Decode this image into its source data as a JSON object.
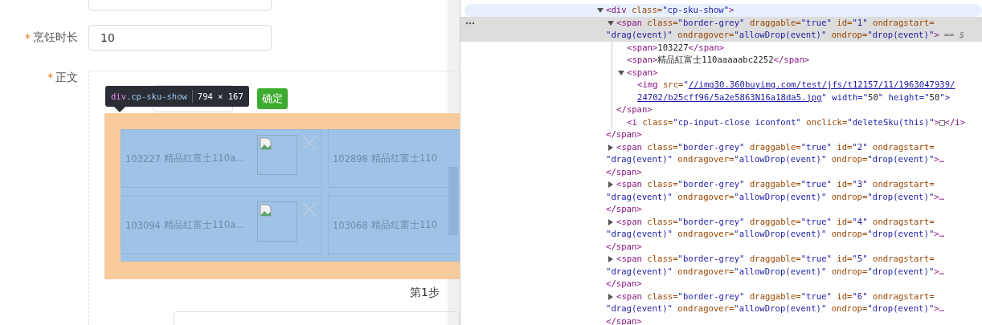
{
  "form": {
    "fields": [
      {
        "label": "烹饪时长",
        "required_mark": "*",
        "value": "10"
      }
    ],
    "body": {
      "label": "正文",
      "required_mark": "*",
      "confirm_button": "确定",
      "inspect_tooltip": {
        "selector_tag": "div",
        "selector_class": ".cp-sku-show",
        "size": "794 × 167"
      },
      "sku_cards": [
        {
          "kind": "full",
          "id": "103227",
          "name": "精品红富士110a…"
        },
        {
          "kind": "clipped",
          "id": "102898",
          "name": "精品红富士110"
        },
        {
          "kind": "full",
          "id": "103094",
          "name": "精品红富士110a…"
        },
        {
          "kind": "clipped",
          "id": "103068",
          "name": "精品红富士110"
        }
      ],
      "step_label": "第1步"
    }
  },
  "devtools": {
    "nodes": [
      {
        "kind": "element",
        "expanded": true,
        "selected": false,
        "hovered": true,
        "lines": [
          "<div class=\"cp-sku-show\">"
        ],
        "children": [
          {
            "kind": "element",
            "expanded": true,
            "selected": true,
            "hovered": false,
            "lines": [
              "<span class=\"border-grey\" draggable=\"true\" id=\"1\" ondragstart=",
              "\"drag(event)\" ondragover=\"allowDrop(event)\" ondrop=\"drop(event)\">"
            ],
            "selected_suffix": "== $",
            "close": "</span>",
            "children": [
              {
                "kind": "text",
                "lines": [
                  "<span>103227</span>"
                ]
              },
              {
                "kind": "text",
                "lines": [
                  "<span>精品紅富士110aaaaabc2252</span>"
                ]
              },
              {
                "kind": "element",
                "expanded": true,
                "selected": false,
                "hovered": false,
                "lines": [
                  "<span>"
                ],
                "close": "</span>",
                "children": [
                  {
                    "kind": "link",
                    "prefix": "<img src=\"",
                    "link_lines": [
                      "//img30.360buyimg.com/test/jfs/t12157/11/1963047939/",
                      "24702/b25cff96/5a2e5863N16a18da5.jpg"
                    ],
                    "suffix": "\" width=\"50\" height=\"50\">"
                  }
                ]
              },
              {
                "kind": "text",
                "lines": [
                  "<i class=\"cp-input-close iconfont\" onclick=\"deleteSku(this)\">□</i>"
                ]
              }
            ]
          },
          {
            "kind": "element",
            "expanded": false,
            "selected": false,
            "hovered": false,
            "lines": [
              "<span class=\"border-grey\" draggable=\"true\" id=\"2\" ondragstart=",
              "\"drag(event)\" ondragover=\"allowDrop(event)\" ondrop=\"drop(event)\">…"
            ],
            "close": "</span>"
          },
          {
            "kind": "element",
            "expanded": false,
            "selected": false,
            "hovered": false,
            "lines": [
              "<span class=\"border-grey\" draggable=\"true\" id=\"3\" ondragstart=",
              "\"drag(event)\" ondragover=\"allowDrop(event)\" ondrop=\"drop(event)\">…"
            ],
            "close": "</span>"
          },
          {
            "kind": "element",
            "expanded": false,
            "selected": false,
            "hovered": false,
            "lines": [
              "<span class=\"border-grey\" draggable=\"true\" id=\"4\" ondragstart=",
              "\"drag(event)\" ondragover=\"allowDrop(event)\" ondrop=\"drop(event)\">…"
            ],
            "close": "</span>"
          },
          {
            "kind": "element",
            "expanded": false,
            "selected": false,
            "hovered": false,
            "lines": [
              "<span class=\"border-grey\" draggable=\"true\" id=\"5\" ondragstart=",
              "\"drag(event)\" ondragover=\"allowDrop(event)\" ondrop=\"drop(event)\">…"
            ],
            "close": "</span>"
          },
          {
            "kind": "element",
            "expanded": false,
            "selected": false,
            "hovered": false,
            "lines": [
              "<span class=\"border-grey\" draggable=\"true\" id=\"6\" ondragstart=",
              "\"drag(event)\" ondragover=\"allowDrop(event)\" ondrop=\"drop(event)\">…"
            ],
            "close": "</span>"
          }
        ]
      }
    ]
  }
}
